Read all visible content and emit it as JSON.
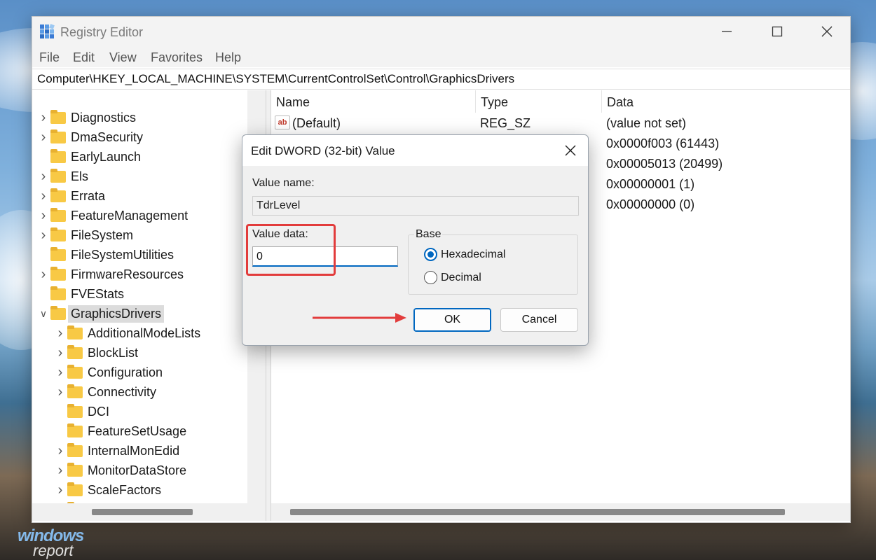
{
  "window": {
    "title": "Registry Editor",
    "minimize_icon": "minimize-icon",
    "maximize_icon": "maximize-icon",
    "close_icon": "close-icon"
  },
  "menu": [
    "File",
    "Edit",
    "View",
    "Favorites",
    "Help"
  ],
  "address": "Computer\\HKEY_LOCAL_MACHINE\\SYSTEM\\CurrentControlSet\\Control\\GraphicsDrivers",
  "tree": {
    "items": [
      {
        "label": "Diagnostics",
        "expandable": true,
        "level": 0
      },
      {
        "label": "DmaSecurity",
        "expandable": true,
        "level": 0
      },
      {
        "label": "EarlyLaunch",
        "expandable": false,
        "level": 0
      },
      {
        "label": "Els",
        "expandable": true,
        "level": 0
      },
      {
        "label": "Errata",
        "expandable": true,
        "level": 0
      },
      {
        "label": "FeatureManagement",
        "expandable": true,
        "level": 0
      },
      {
        "label": "FileSystem",
        "expandable": true,
        "level": 0
      },
      {
        "label": "FileSystemUtilities",
        "expandable": false,
        "level": 0
      },
      {
        "label": "FirmwareResources",
        "expandable": true,
        "level": 0
      },
      {
        "label": "FVEStats",
        "expandable": false,
        "level": 0
      },
      {
        "label": "GraphicsDrivers",
        "expandable": true,
        "expanded": true,
        "selected": true,
        "level": 0
      },
      {
        "label": "AdditionalModeLists",
        "expandable": true,
        "level": 1
      },
      {
        "label": "BlockList",
        "expandable": true,
        "level": 1
      },
      {
        "label": "Configuration",
        "expandable": true,
        "level": 1
      },
      {
        "label": "Connectivity",
        "expandable": true,
        "level": 1
      },
      {
        "label": "DCI",
        "expandable": false,
        "level": 1
      },
      {
        "label": "FeatureSetUsage",
        "expandable": false,
        "level": 1
      },
      {
        "label": "InternalMonEdid",
        "expandable": true,
        "level": 1
      },
      {
        "label": "MonitorDataStore",
        "expandable": true,
        "level": 1
      },
      {
        "label": "ScaleFactors",
        "expandable": true,
        "level": 1
      },
      {
        "label": "UseNewKey",
        "expandable": false,
        "level": 1
      }
    ]
  },
  "list": {
    "columns": [
      "Name",
      "Type",
      "Data"
    ],
    "rows": [
      {
        "name": "(Default)",
        "type": "REG_SZ",
        "data": "(value not set)",
        "icon": "string-value-icon"
      },
      {
        "name": "",
        "type": "",
        "data": "0x0000f003 (61443)"
      },
      {
        "name": "",
        "type": "",
        "data": "0x00005013 (20499)"
      },
      {
        "name": "",
        "type": "",
        "data": "0x00000001 (1)"
      },
      {
        "name": "",
        "type": "",
        "data": "0x00000000 (0)"
      }
    ]
  },
  "dialog": {
    "title": "Edit DWORD (32-bit) Value",
    "value_name_label": "Value name:",
    "value_name": "TdrLevel",
    "value_data_label": "Value data:",
    "value_data": "0",
    "base_label": "Base",
    "radio_hex": "Hexadecimal",
    "radio_dec": "Decimal",
    "selected_base": "Hexadecimal",
    "ok": "OK",
    "cancel": "Cancel"
  },
  "annotations": {
    "highlight_color": "#e23c3c"
  },
  "watermark": {
    "line1": "windows",
    "line2": "report"
  }
}
